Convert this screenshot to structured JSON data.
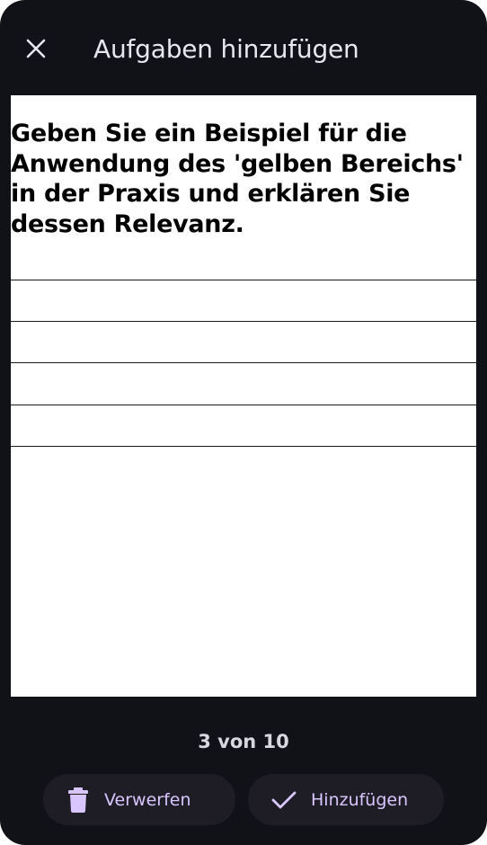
{
  "colors": {
    "background": "#111118",
    "card": "#ffffff",
    "button_bg": "#1e1d26",
    "accent": "#d9c6ff",
    "title_text": "#e8e6ee"
  },
  "header": {
    "close_icon": "close-icon",
    "title": "Aufgaben hinzufügen"
  },
  "task": {
    "question": "Geben Sie ein Beispiel für die Anwendung des 'gelben Bereichs' in der Praxis und erklären Sie dessen Relevanz.",
    "answer_line_count": 5
  },
  "pager": {
    "text": "3 von 10"
  },
  "actions": {
    "discard": {
      "icon": "trash-icon",
      "label": "Verwerfen"
    },
    "add": {
      "icon": "check-icon",
      "label": "Hinzufügen"
    }
  }
}
